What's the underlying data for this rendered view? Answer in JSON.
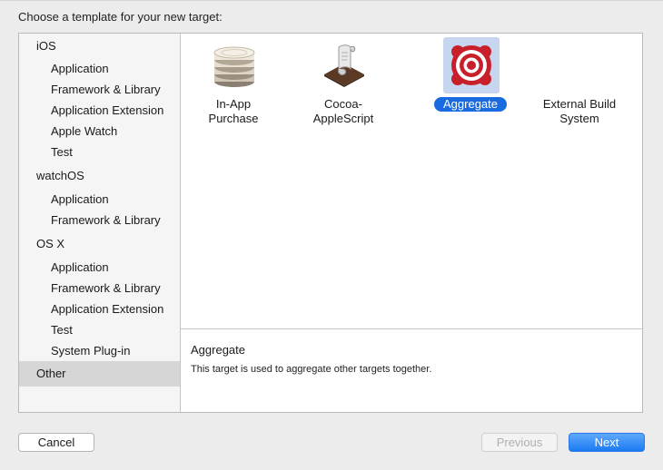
{
  "dialog": {
    "prompt": "Choose a template for your new target:"
  },
  "sidebar": {
    "groups": [
      {
        "title": "iOS",
        "items": [
          "Application",
          "Framework & Library",
          "Application Extension",
          "Apple Watch",
          "Test"
        ]
      },
      {
        "title": "watchOS",
        "items": [
          "Application",
          "Framework & Library"
        ]
      },
      {
        "title": "OS X",
        "items": [
          "Application",
          "Framework & Library",
          "Application Extension",
          "Test",
          "System Plug-in"
        ]
      }
    ],
    "other": "Other",
    "selected": "Other"
  },
  "templates": [
    {
      "name": "In-App Purchase",
      "line1": "In-App",
      "line2": "Purchase",
      "icon": "coin-stack-icon"
    },
    {
      "name": "Cocoa-AppleScript",
      "line1": "Cocoa-",
      "line2": "AppleScript",
      "icon": "script-scroll-icon"
    },
    {
      "name": "Aggregate",
      "line1": "Aggregate",
      "line2": "",
      "icon": "target-icon",
      "selected": true
    },
    {
      "name": "External Build System",
      "line1": "External Build",
      "line2": "System",
      "icon": "none"
    }
  ],
  "description": {
    "title": "Aggregate",
    "text": "This target is used to aggregate other targets together."
  },
  "buttons": {
    "cancel": "Cancel",
    "previous": "Previous",
    "next": "Next"
  },
  "colors": {
    "accent": "#1a6be0",
    "selection_bg": "#c6d6ee",
    "target_red": "#c8202a"
  }
}
